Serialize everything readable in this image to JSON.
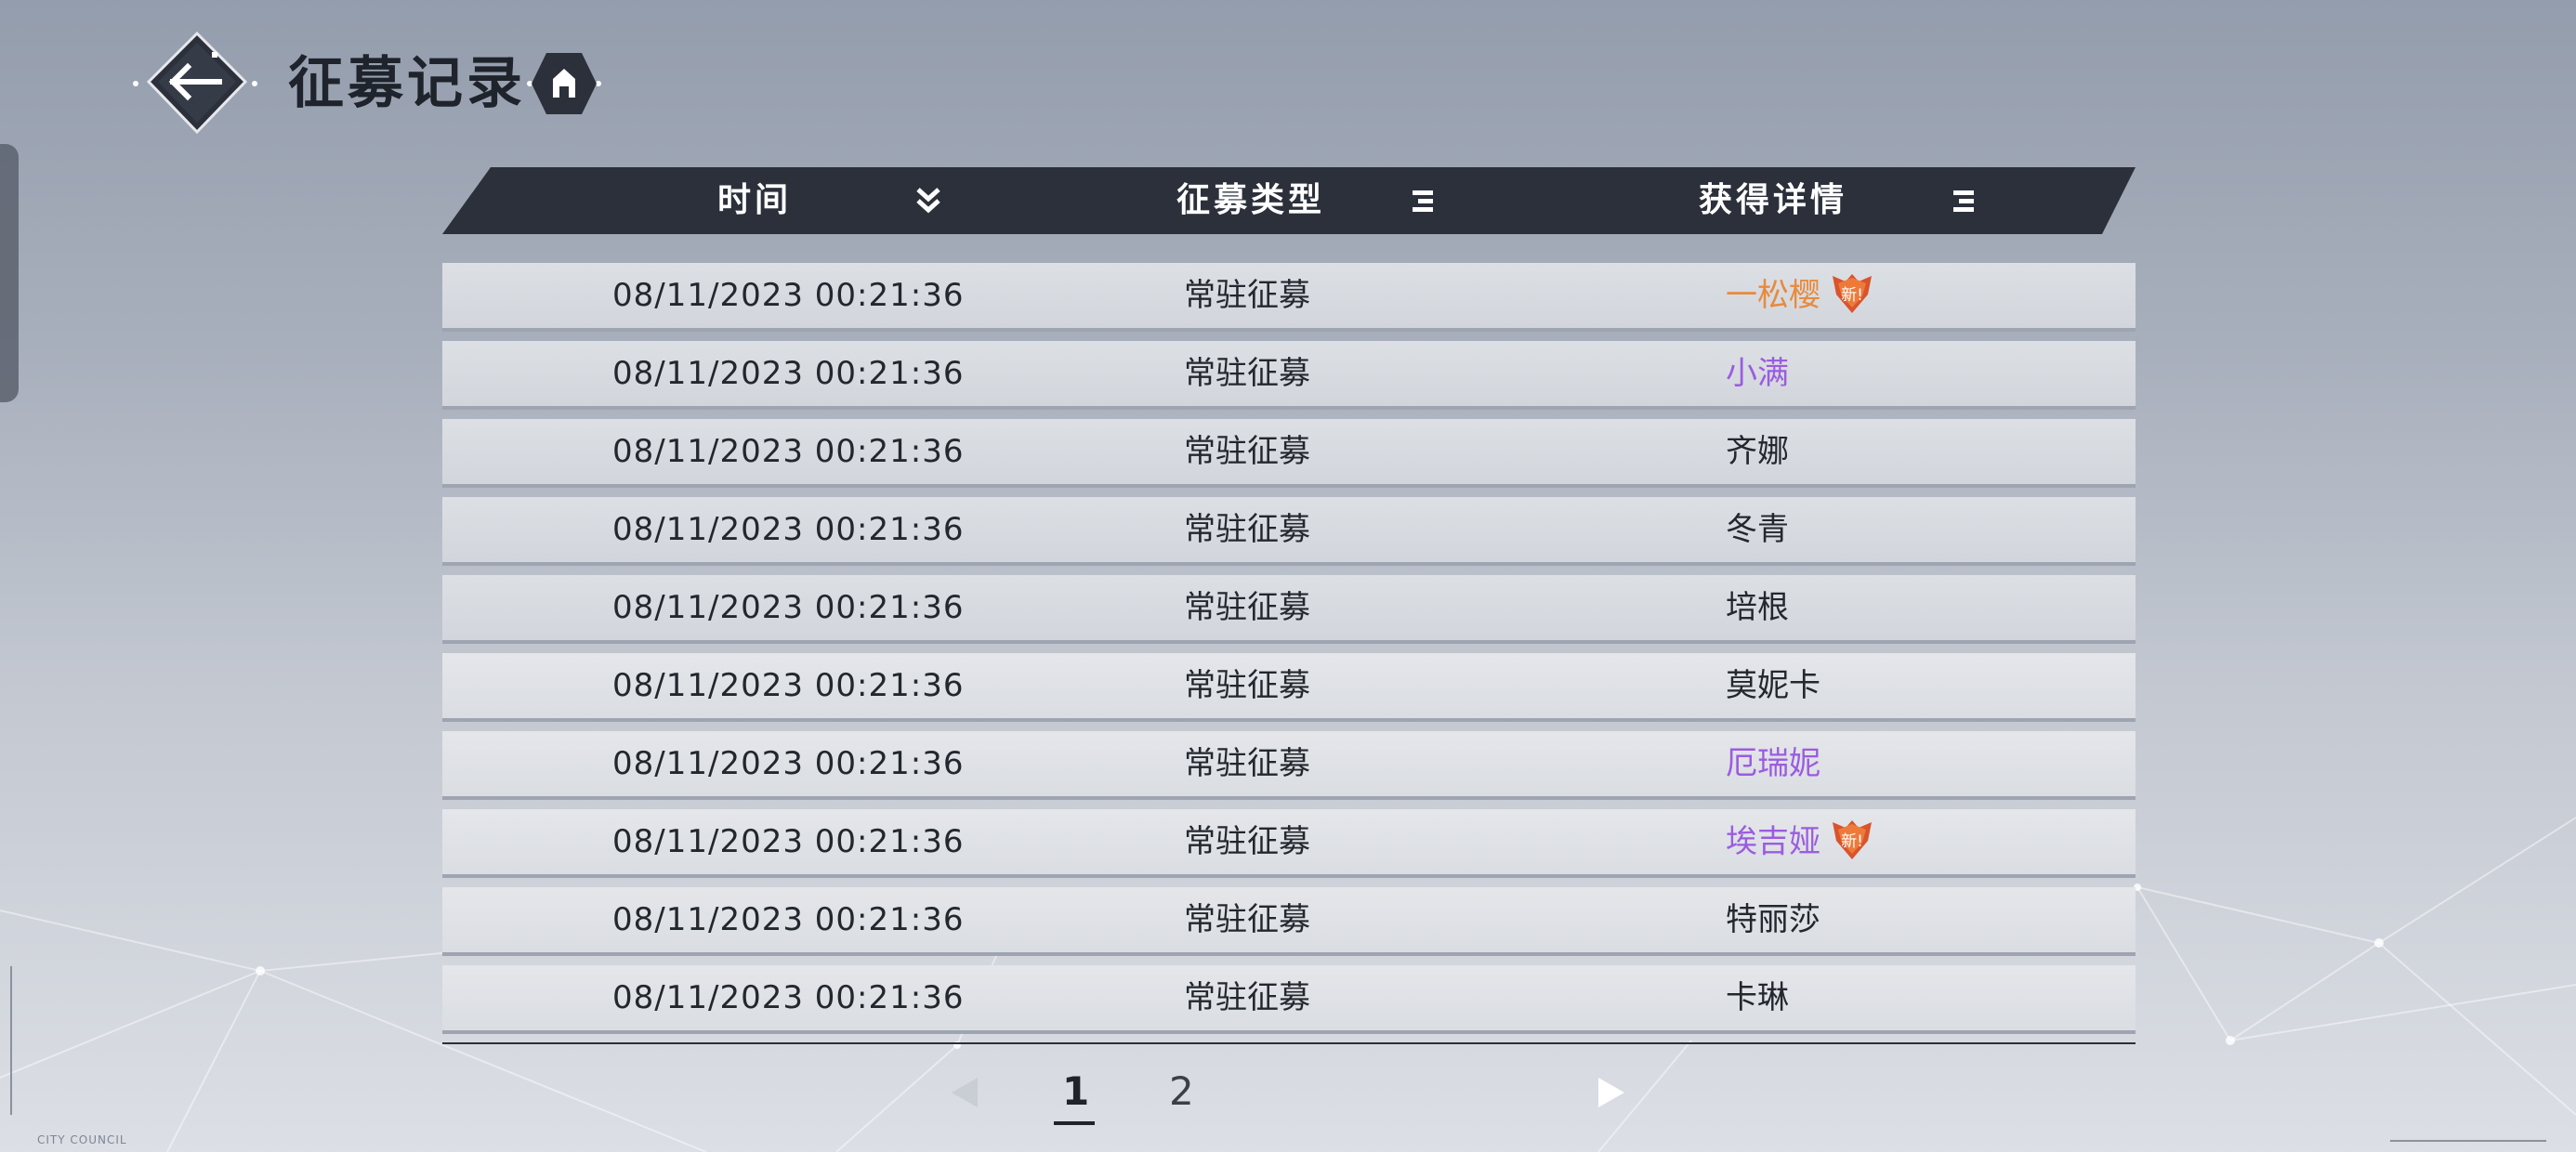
{
  "header": {
    "title": "征募记录"
  },
  "table": {
    "columns": [
      {
        "label": "时间",
        "sort_icon": "chevron-double-down-icon"
      },
      {
        "label": "征募类型",
        "sort_icon": "filter-lines-icon"
      },
      {
        "label": "获得详情",
        "sort_icon": "filter-lines-icon"
      }
    ],
    "rows": [
      {
        "time": "08/11/2023 00:21:36",
        "type": "常驻征募",
        "detail": "一松樱",
        "rarity_color": "#e88a3d",
        "is_new": true,
        "new_label": "新!"
      },
      {
        "time": "08/11/2023 00:21:36",
        "type": "常驻征募",
        "detail": "小满",
        "rarity_color": "#9b5ce0",
        "is_new": false
      },
      {
        "time": "08/11/2023 00:21:36",
        "type": "常驻征募",
        "detail": "齐娜",
        "rarity_color": "#23272e",
        "is_new": false
      },
      {
        "time": "08/11/2023 00:21:36",
        "type": "常驻征募",
        "detail": "冬青",
        "rarity_color": "#23272e",
        "is_new": false
      },
      {
        "time": "08/11/2023 00:21:36",
        "type": "常驻征募",
        "detail": "培根",
        "rarity_color": "#23272e",
        "is_new": false
      },
      {
        "time": "08/11/2023 00:21:36",
        "type": "常驻征募",
        "detail": "莫妮卡",
        "rarity_color": "#23272e",
        "is_new": false
      },
      {
        "time": "08/11/2023 00:21:36",
        "type": "常驻征募",
        "detail": "厄瑞妮",
        "rarity_color": "#9b5ce0",
        "is_new": false
      },
      {
        "time": "08/11/2023 00:21:36",
        "type": "常驻征募",
        "detail": "埃吉娅",
        "rarity_color": "#9b5ce0",
        "is_new": true,
        "new_label": "新!"
      },
      {
        "time": "08/11/2023 00:21:36",
        "type": "常驻征募",
        "detail": "特丽莎",
        "rarity_color": "#23272e",
        "is_new": false
      },
      {
        "time": "08/11/2023 00:21:36",
        "type": "常驻征募",
        "detail": "卡琳",
        "rarity_color": "#23272e",
        "is_new": false
      }
    ]
  },
  "pagination": {
    "pages": [
      "1",
      "2"
    ],
    "current": "1"
  },
  "footer": {
    "left_small": "CITY COUNCIL"
  },
  "colors": {
    "header_bar": "#2b303b",
    "orange_rarity": "#e88a3d",
    "purple_rarity": "#9b5ce0"
  }
}
